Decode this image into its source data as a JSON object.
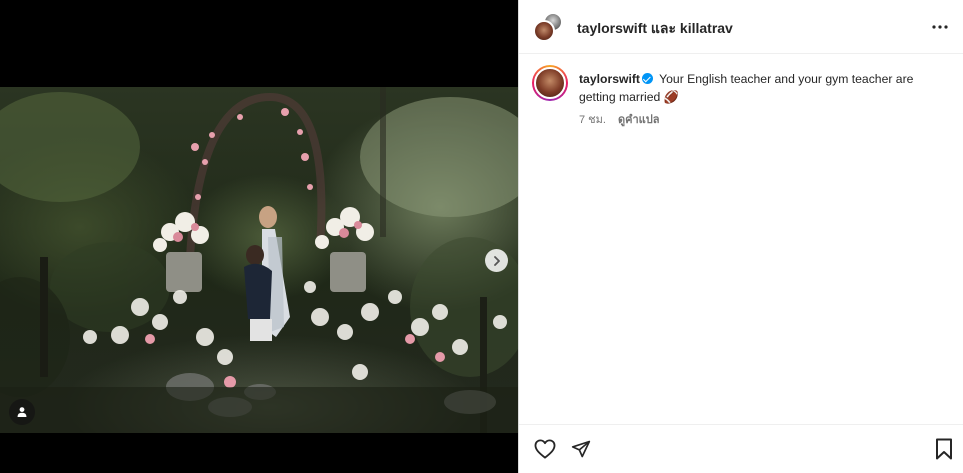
{
  "header": {
    "title": "taylorswift และ killatrav"
  },
  "caption": {
    "username": "taylorswift",
    "text": "Your English teacher and your gym teacher are getting married 🏈",
    "time": "7 ชม.",
    "see_translation": "ดูคำแปล"
  },
  "icons": {
    "more": "more-options-icon",
    "like": "heart-icon",
    "share": "paper-plane-icon",
    "save": "bookmark-icon",
    "next": "chevron-right-icon",
    "tags": "user-tag-icon",
    "verified": "verified-badge-icon"
  },
  "colors": {
    "verified": "#0095f6",
    "text": "#262626",
    "secondary": "#737373"
  }
}
